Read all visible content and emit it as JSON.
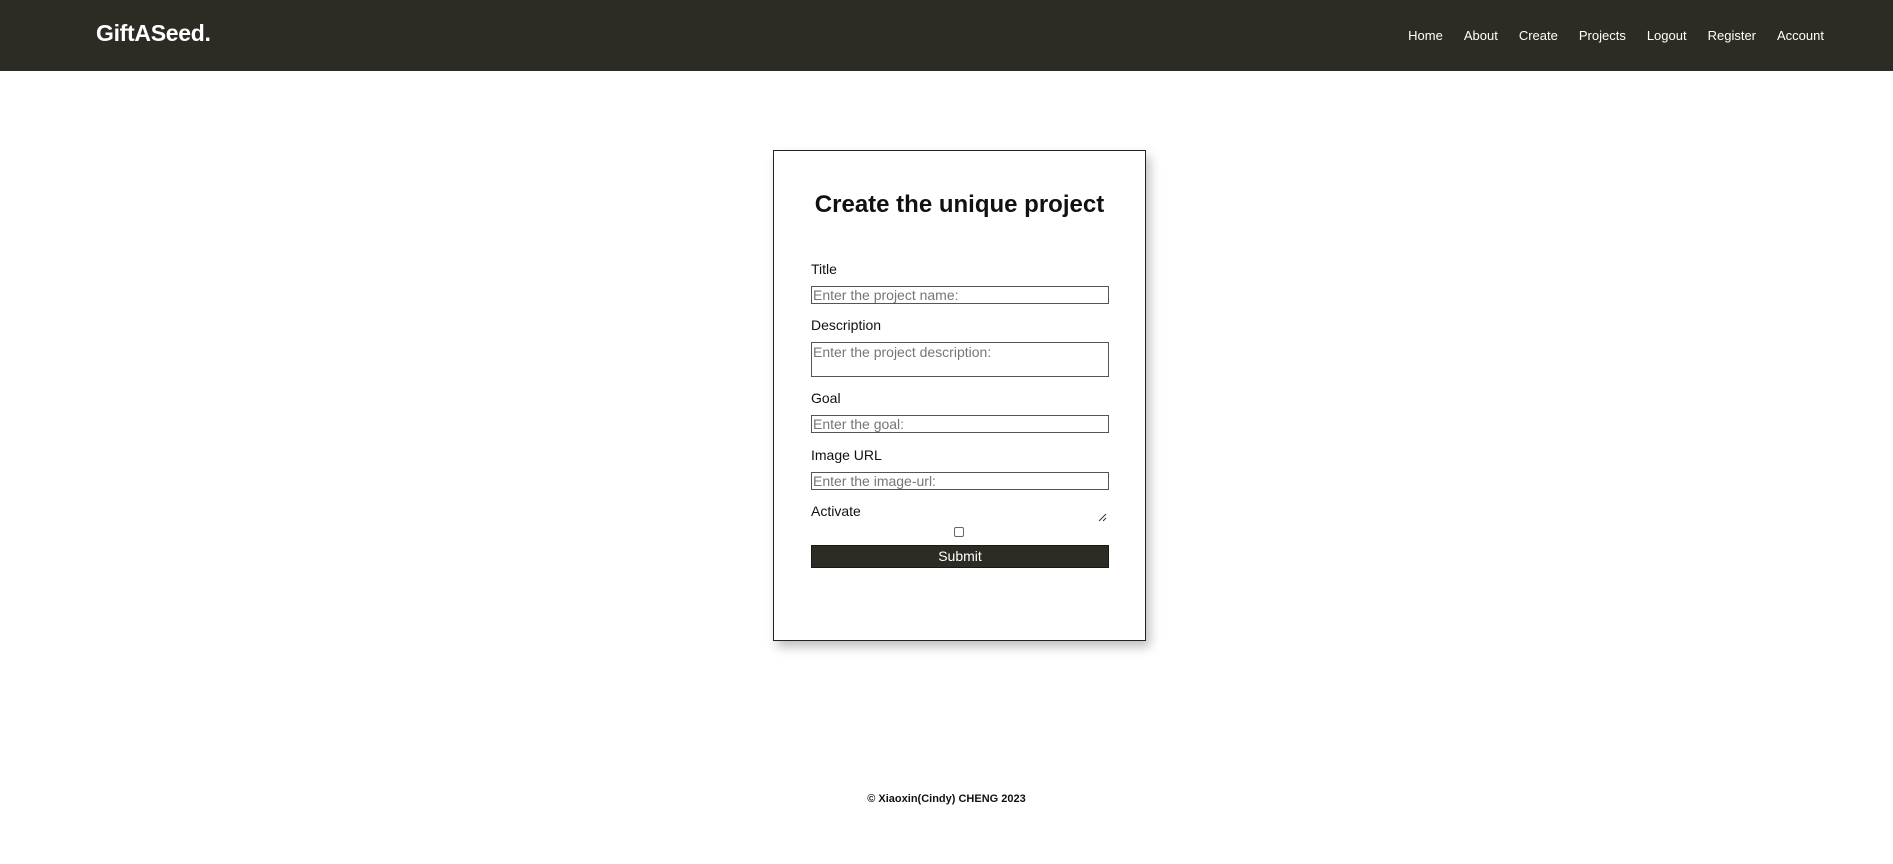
{
  "header": {
    "brand": "GiftASeed.",
    "nav": [
      {
        "label": "Home"
      },
      {
        "label": "About"
      },
      {
        "label": "Create"
      },
      {
        "label": "Projects"
      },
      {
        "label": "Logout"
      },
      {
        "label": "Register"
      },
      {
        "label": "Account"
      }
    ]
  },
  "form": {
    "heading": "Create the unique project",
    "title": {
      "label": "Title",
      "placeholder": "Enter the project name:",
      "value": ""
    },
    "description": {
      "label": "Description",
      "placeholder": "Enter the project description:",
      "value": ""
    },
    "goal": {
      "label": "Goal",
      "placeholder": "Enter the goal:",
      "value": ""
    },
    "image_url": {
      "label": "Image URL",
      "placeholder": "Enter the image-url:",
      "value": ""
    },
    "activate": {
      "label": "Activate",
      "checked": false
    },
    "submit_label": "Submit"
  },
  "footer": {
    "text": "© Xiaoxin(Cindy) CHENG 2023"
  },
  "colors": {
    "navbar_bg": "#2d2c24",
    "button_bg": "#2d2c24"
  }
}
